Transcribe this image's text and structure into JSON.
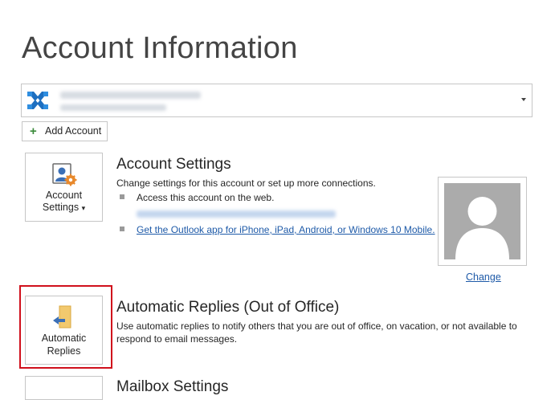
{
  "header": {
    "title": "Account Information"
  },
  "account_selector": {
    "icon": "exchange-icon"
  },
  "add_account": {
    "label": "Add Account",
    "icon": "plus-icon",
    "icon_color": "#3a8a3a"
  },
  "account_settings": {
    "tile_line1": "Account",
    "tile_line2": "Settings",
    "tile_caret": "▾",
    "title": "Account Settings",
    "description": "Change settings for this account or set up more connections.",
    "bullets": [
      {
        "text": "Access this account on the web."
      },
      {
        "text": "Get the Outlook app for iPhone, iPad, Android, or Windows 10 Mobile."
      }
    ]
  },
  "profile_photo": {
    "change_label": "Change"
  },
  "automatic_replies": {
    "tile_line1": "Automatic",
    "tile_line2": "Replies",
    "title": "Automatic Replies (Out of Office)",
    "description_line1": "Use automatic replies to notify others that you are out of office, on vacation, or not available to",
    "description_line2": "respond to email messages."
  },
  "mailbox_settings": {
    "title": "Mailbox Settings"
  },
  "colors": {
    "link": "#1e5aa8",
    "highlight": "#d0101c",
    "exchange_blue": "#1e6fc0"
  }
}
